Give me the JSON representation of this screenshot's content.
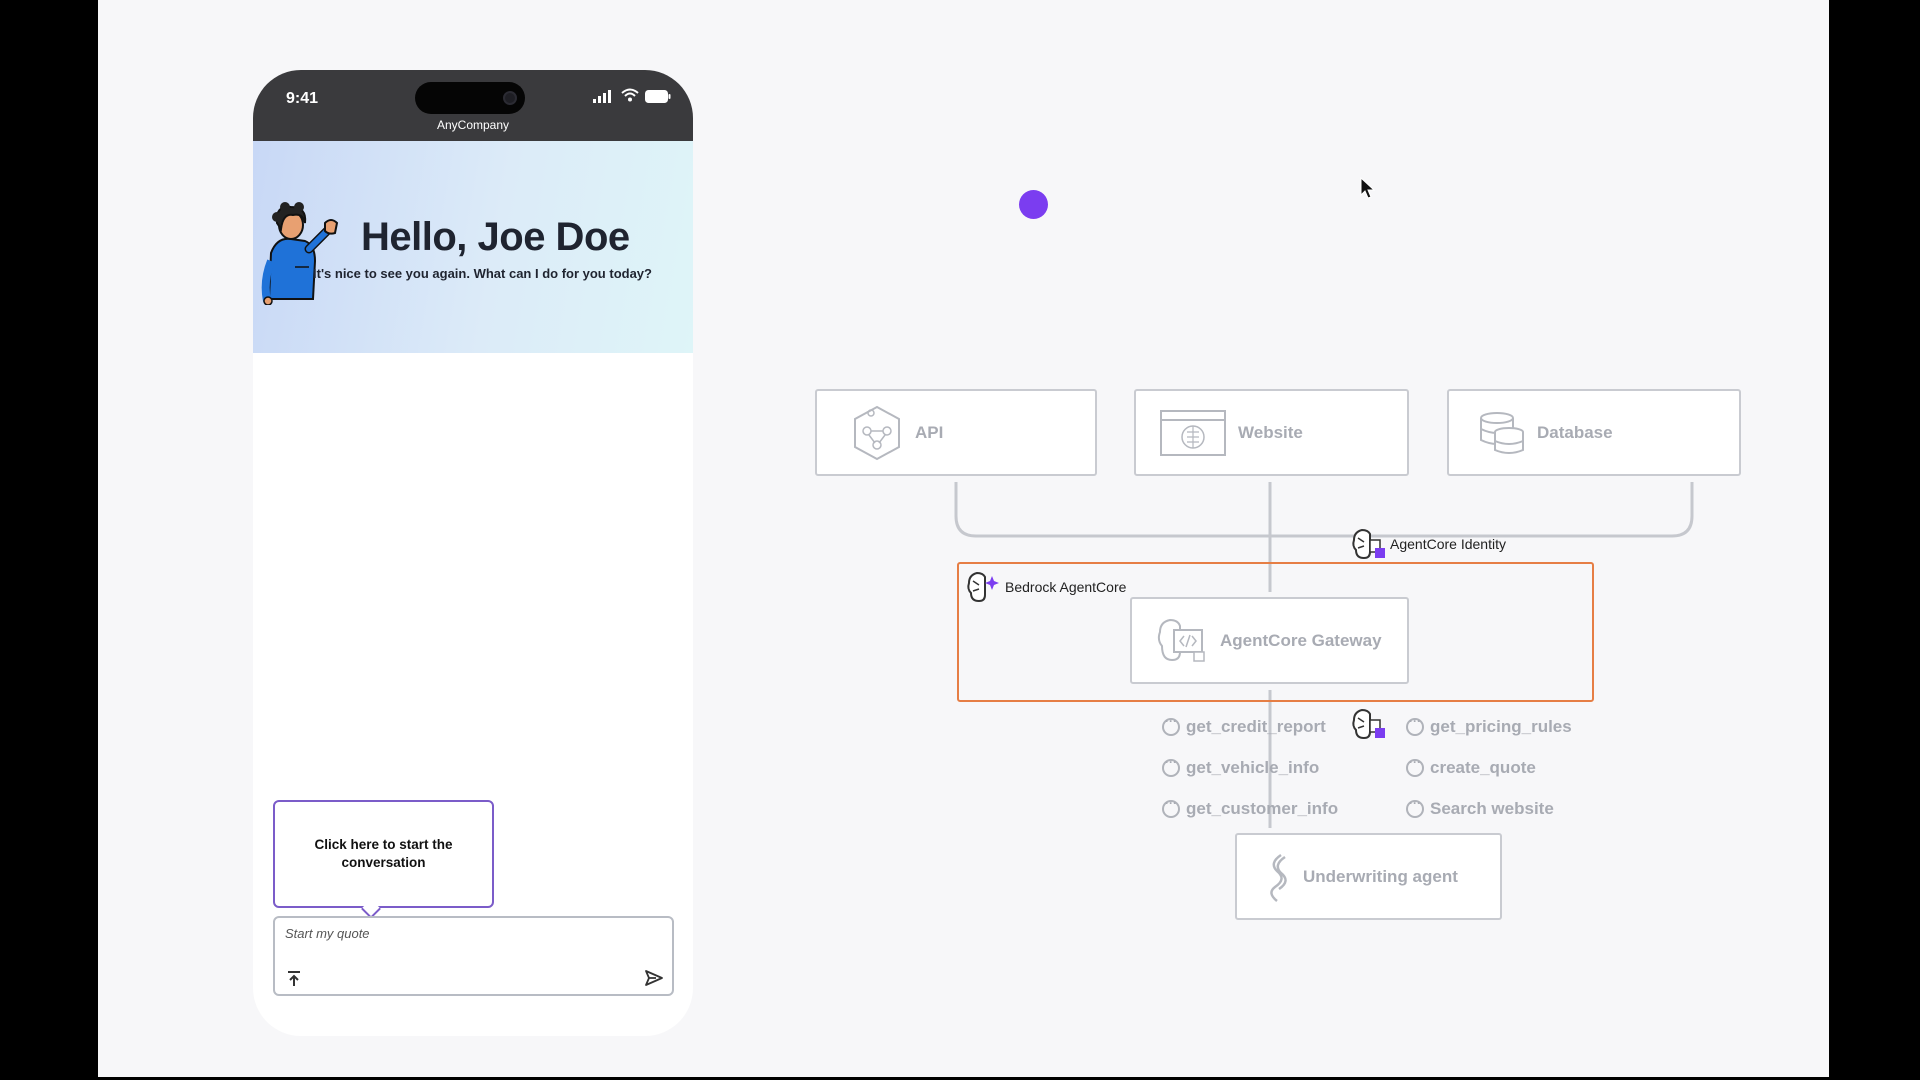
{
  "phone": {
    "time": "9:41",
    "app_name": "AnyCompany",
    "greeting": "Hello, Joe Doe",
    "subgreeting": "It's nice to see you again. What can I do for you today?",
    "tooltip": "Click here to start the conversation",
    "input_placeholder": "Start my quote",
    "icons": [
      "signal-icon",
      "wifi-icon",
      "battery-icon",
      "attach-icon",
      "send-icon"
    ]
  },
  "diagram": {
    "sources": [
      {
        "label": "API",
        "icon": "api-icon"
      },
      {
        "label": "Website",
        "icon": "website-icon"
      },
      {
        "label": "Database",
        "icon": "database-icon"
      }
    ],
    "identity_label": "AgentCore Identity",
    "agentcore_label": "Bedrock AgentCore",
    "gateway_label": "AgentCore Gateway",
    "tools_left": [
      "get_credit_report",
      "get_vehicle_info",
      "get_customer_info"
    ],
    "tools_right": [
      "get_pricing_rules",
      "create_quote",
      "Search website"
    ],
    "agent_label": "Underwriting agent",
    "colors": {
      "agentcore_border": "#e67e45",
      "accent_purple": "#7b3df0",
      "tooltip_border": "#7b5cc9"
    }
  }
}
